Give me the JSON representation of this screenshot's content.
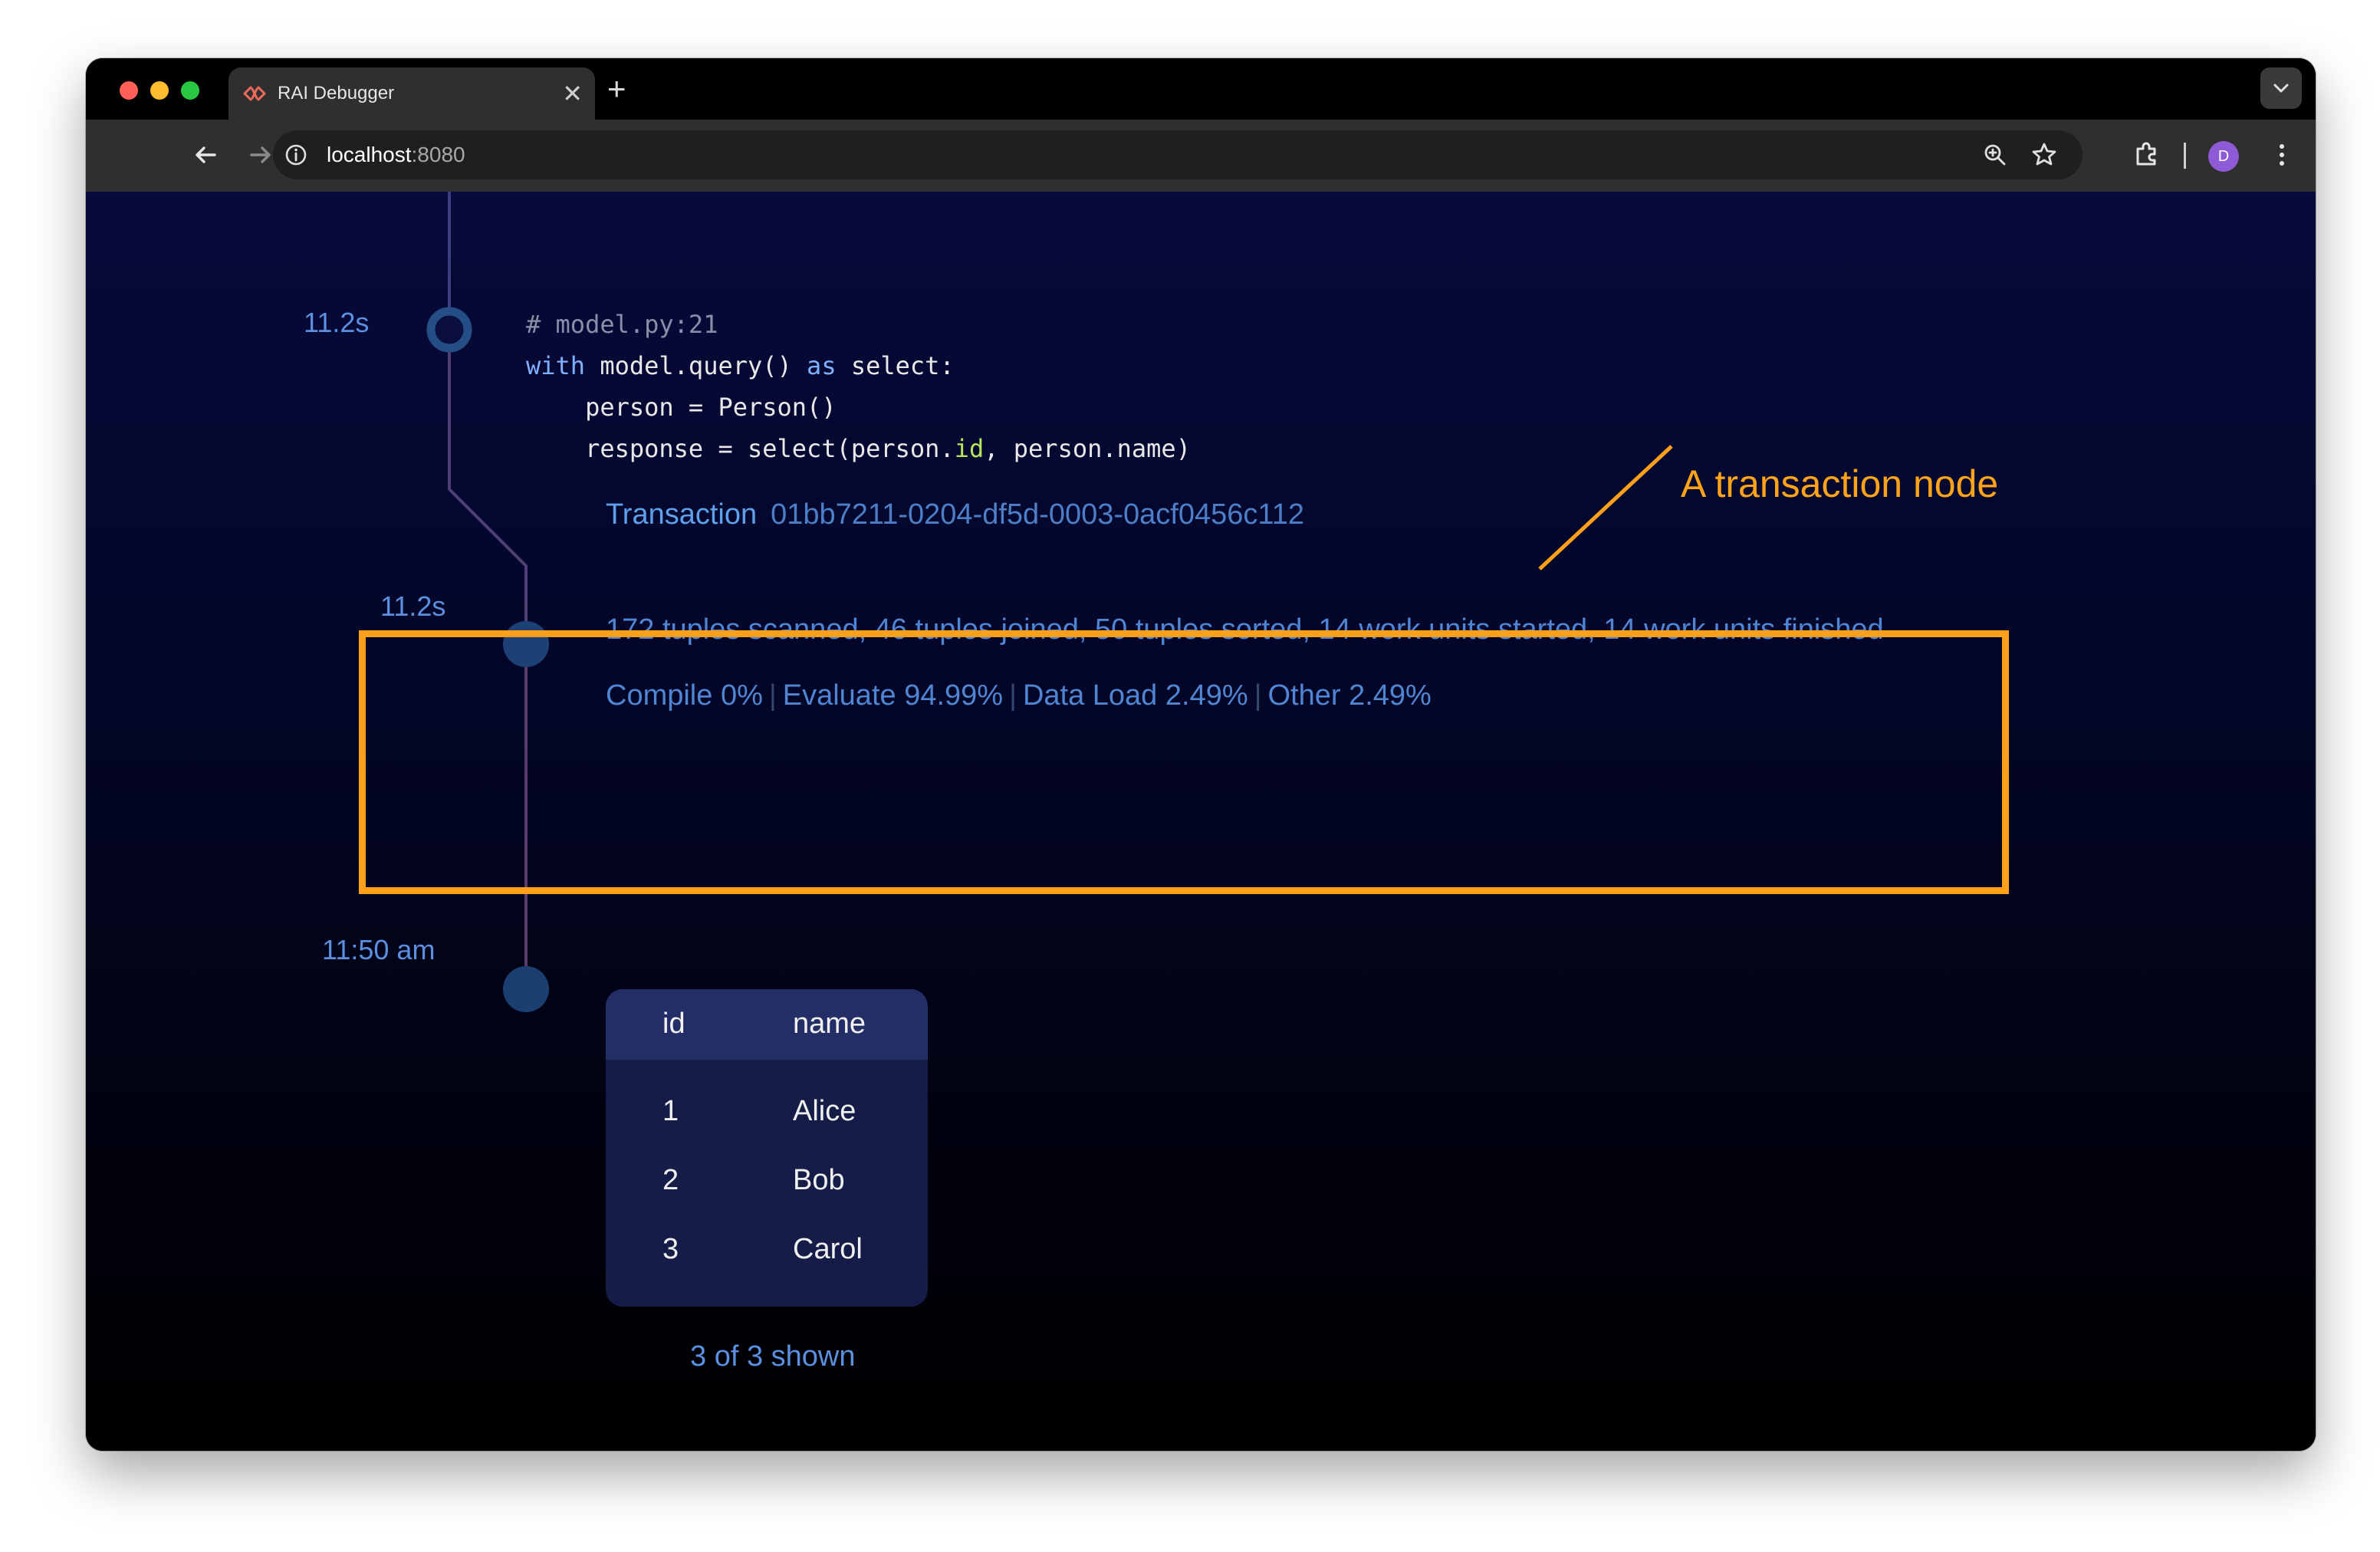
{
  "browser": {
    "tab_title": "RAI Debugger",
    "tab_close": "✕",
    "new_tab": "+",
    "url_host": "localhost",
    "url_port": ":8080",
    "avatar_initial": "D"
  },
  "timeline": {
    "query_node": {
      "time": "11.2s",
      "code_lines": {
        "comment": "# model.py:21",
        "line2_kw1": "with",
        "line2_mid": " model.query() ",
        "line2_kw2": "as",
        "line2_end": " select:",
        "line3": "    person = Person()",
        "line4_start": "    response = select(person.",
        "line4_attr": "id",
        "line4_end": ", person.name)"
      }
    },
    "transaction_node": {
      "time": "11.2s",
      "label": "Transaction",
      "id": "01bb7211-0204-df5d-0003-0acf0456c112",
      "stats": "172 tuples scanned, 46 tuples joined, 50 tuples sorted, 14 work units started, 14 work units finished",
      "timing": {
        "compile": "Compile 0%",
        "evaluate": "Evaluate 94.99%",
        "data_load": "Data Load 2.49%",
        "other": "Other 2.49%",
        "separator": "|"
      }
    },
    "result_node": {
      "time": "11:50 am",
      "columns": [
        "id",
        "name"
      ],
      "rows": [
        [
          "1",
          "Alice"
        ],
        [
          "2",
          "Bob"
        ],
        [
          "3",
          "Carol"
        ]
      ],
      "shown": "3 of 3 shown"
    }
  },
  "annotation": {
    "label": "A transaction node",
    "color": "#ff9f1a"
  }
}
